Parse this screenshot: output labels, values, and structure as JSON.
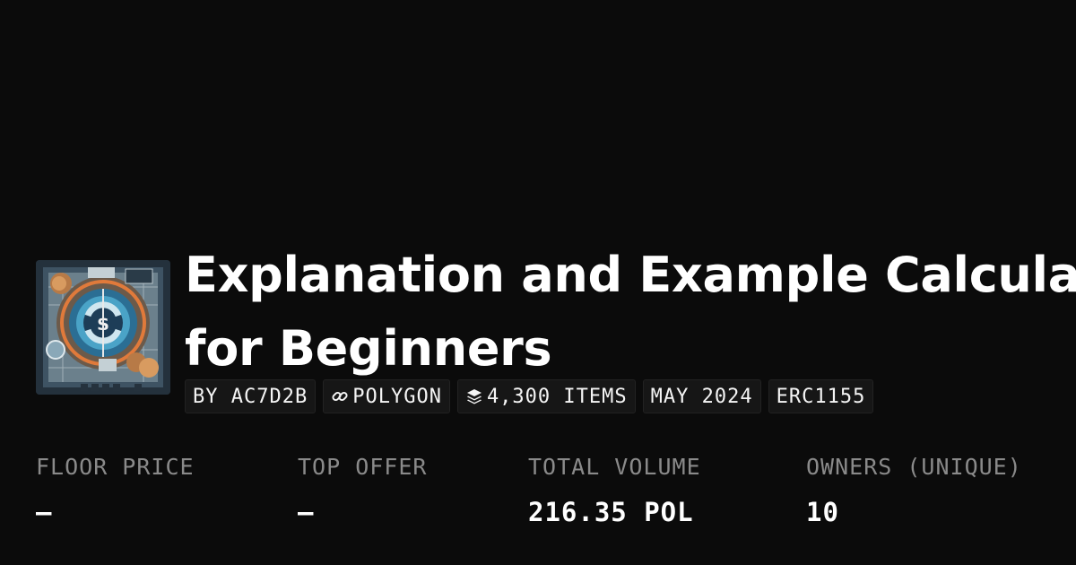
{
  "collection": {
    "title_line1": "Explanation and Example Calculat",
    "title_line2": "for Beginners",
    "thumbnail_icon": "dollar-coin-circuit-artwork"
  },
  "tags": {
    "creator": "BY AC7D2B",
    "chain": "POLYGON",
    "chain_icon": "link-icon",
    "items": "4,300 ITEMS",
    "items_icon": "layers-icon",
    "date": "MAY 2024",
    "standard": "ERC1155"
  },
  "stats": {
    "floor_price": {
      "label": "FLOOR PRICE",
      "value": "–"
    },
    "top_offer": {
      "label": "TOP OFFER",
      "value": "–"
    },
    "total_volume": {
      "label": "TOTAL VOLUME",
      "value": "216.35 POL"
    },
    "owners": {
      "label": "OWNERS (UNIQUE)",
      "value": "10"
    }
  },
  "colors": {
    "background": "#0b0b0b",
    "text": "#ffffff",
    "muted": "#8a8a8a",
    "tag_background": "#161616"
  }
}
